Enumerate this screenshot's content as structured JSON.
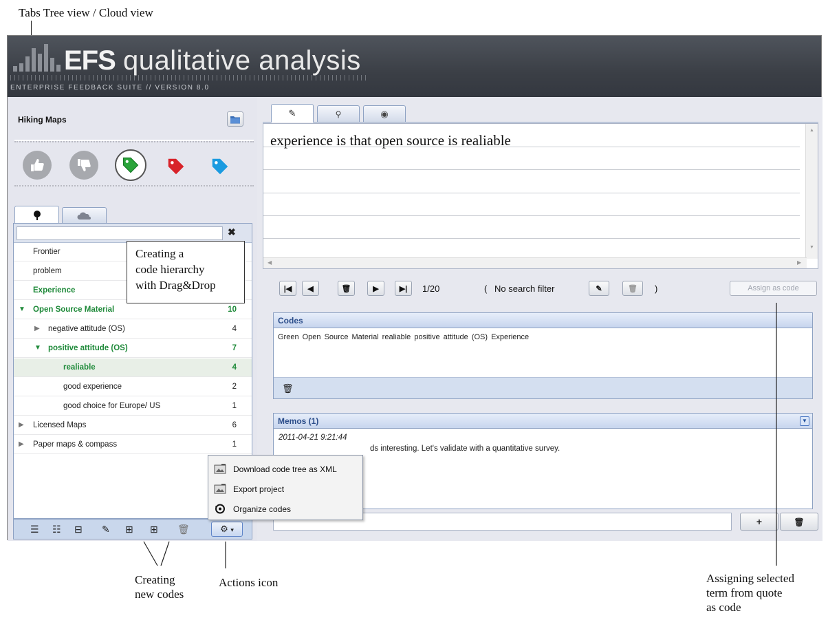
{
  "annotations": {
    "tabs_view": "Tabs Tree view / Cloud view",
    "callout_line1": "Creating a",
    "callout_line2": "code hierarchy",
    "callout_line3": "with Drag&Drop",
    "creating_line1": "Creating",
    "creating_line2": "new codes",
    "actions": "Actions icon",
    "assign_line1": "Assigning selected",
    "assign_line2": "term from quote",
    "assign_line3": "as code"
  },
  "banner": {
    "brand": "EFS",
    "product": "qualitative analysis",
    "subtitle": "ENTERPRISE FEEDBACK SUITE // VERSION 8.0"
  },
  "project": {
    "title": "Hiking Maps"
  },
  "rating_icons": [
    "thumbs-up-icon",
    "thumbs-down-icon",
    "green-tag-icon",
    "red-tag-icon",
    "blue-tag-icon"
  ],
  "tree": {
    "rows": [
      {
        "label": "Frontier",
        "count": "",
        "level": 0,
        "expander": "none"
      },
      {
        "label": "problem",
        "count": "",
        "level": 0,
        "expander": "none"
      },
      {
        "label": "Experience",
        "count": "",
        "level": 0,
        "expander": "none",
        "highlight": true
      },
      {
        "label": "Open Source Material",
        "count": "10",
        "level": 0,
        "expander": "open",
        "highlight": true
      },
      {
        "label": "negative attitude (OS)",
        "count": "4",
        "level": 1,
        "expander": "closed"
      },
      {
        "label": "positive attitude (OS)",
        "count": "7",
        "level": 1,
        "expander": "open",
        "highlight": true
      },
      {
        "label": "realiable",
        "count": "4",
        "level": 2,
        "expander": "none",
        "highlight": true
      },
      {
        "label": "good experience",
        "count": "2",
        "level": 2,
        "expander": "none"
      },
      {
        "label": "good choice for Europe/ US",
        "count": "1",
        "level": 2,
        "expander": "none"
      },
      {
        "label": "Licensed Maps",
        "count": "6",
        "level": 0,
        "expander": "closed"
      },
      {
        "label": "Paper maps & compass",
        "count": "1",
        "level": 0,
        "expander": "closed"
      }
    ]
  },
  "quote": {
    "text": "experience is that open source is realiable"
  },
  "navigation": {
    "position": "1/20",
    "filter_open": "(",
    "filter_text": "No search filter",
    "filter_close": ")",
    "assign_label": "Assign as code"
  },
  "codes": {
    "title": "Codes",
    "items": "Green    Open Source Material    realiable    positive attitude (OS)    Experience"
  },
  "memos": {
    "title": "Memos (1)",
    "date": "2011-04-21 9:21:44",
    "text": "ds interesting. Let's validate with a quantitative survey."
  },
  "menu": {
    "items": [
      "Download code tree as XML",
      "Export project",
      "Organize codes"
    ]
  }
}
